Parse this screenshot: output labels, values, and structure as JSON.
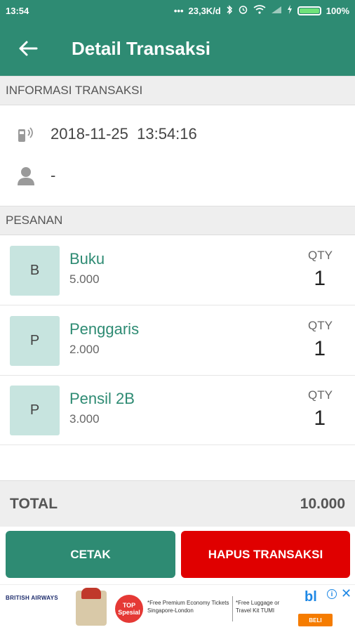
{
  "status_bar": {
    "time": "13:54",
    "dots": "•••",
    "network_speed": "23,3K/d",
    "battery": "100%",
    "battery_level": 1.0
  },
  "app_bar": {
    "title": "Detail Transaksi",
    "back_icon": "arrow-left-icon"
  },
  "info_section": {
    "header": "INFORMASI TRANSAKSI",
    "datetime": "2018-11-25  13:54:16",
    "datetime_icon": "nfc-reader-icon",
    "customer": "-",
    "customer_icon": "person-icon"
  },
  "order_section": {
    "header": "PESANAN",
    "qty_label": "QTY",
    "items": [
      {
        "initial": "B",
        "name": "Buku",
        "price": "5.000",
        "qty": "1"
      },
      {
        "initial": "P",
        "name": "Penggaris",
        "price": "2.000",
        "qty": "1"
      },
      {
        "initial": "P",
        "name": "Pensil 2B",
        "price": "3.000",
        "qty": "1"
      }
    ]
  },
  "total": {
    "label": "TOTAL",
    "value": "10.000"
  },
  "actions": {
    "print_label": "CETAK",
    "delete_label": "HAPUS TRANSAKSI"
  },
  "ad_banner": {
    "brand": "BRITISH AIRWAYS",
    "badge": "TOP Spesial",
    "text1": "*Free Premium Economy Tickets Singapore-London",
    "text2": "*Free Luggage or Travel Kit TUMI",
    "logo": "bl",
    "cta": "BELI",
    "info_icon": "info-icon",
    "close_icon": "close-icon"
  },
  "colors": {
    "primary": "#2e8b73",
    "danger": "#e00000",
    "avatar_bg": "#c7e4df"
  }
}
